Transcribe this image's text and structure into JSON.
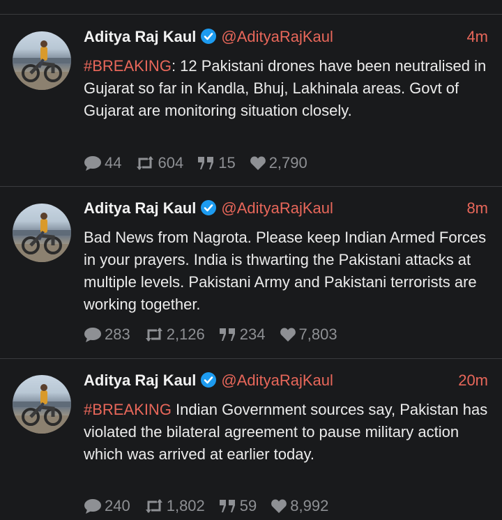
{
  "tweets": [
    {
      "author": "Aditya Raj Kaul",
      "handle": "@AdityaRajKaul",
      "time": "4m",
      "hashtag": "#BREAKING",
      "text": ": 12 Pakistani drones have been neutralised in Gujarat so far in Kandla, Bhuj, Lakhinala areas. Govt of Gujarat are monitoring situation closely.",
      "replies": "44",
      "retweets": "604",
      "quotes": "15",
      "likes": "2,790"
    },
    {
      "author": "Aditya Raj Kaul",
      "handle": "@AdityaRajKaul",
      "time": "8m",
      "hashtag": "",
      "text": "Bad News from Nagrota. Please keep Indian Armed Forces in your prayers. India is thwarting the Pakistani attacks at multiple levels. Pakistani Army and Pakistani terrorists are working together.",
      "replies": "283",
      "retweets": "2,126",
      "quotes": "234",
      "likes": "7,803"
    },
    {
      "author": "Aditya Raj Kaul",
      "handle": "@AdityaRajKaul",
      "time": "20m",
      "hashtag": "#BREAKING",
      "text": " Indian Government sources say, Pakistan has violated the bilateral agreement to pause military action which was arrived at earlier today.",
      "replies": "240",
      "retweets": "1,802",
      "quotes": "59",
      "likes": "8,992"
    }
  ],
  "icons": {
    "verified": "verified-badge-icon",
    "reply": "reply-icon",
    "retweet": "retweet-icon",
    "quote": "quote-icon",
    "like": "heart-icon"
  },
  "colors": {
    "background": "#191a1c",
    "accent": "#e8675a",
    "verified": "#1d9bf0",
    "muted": "#8e9094"
  }
}
